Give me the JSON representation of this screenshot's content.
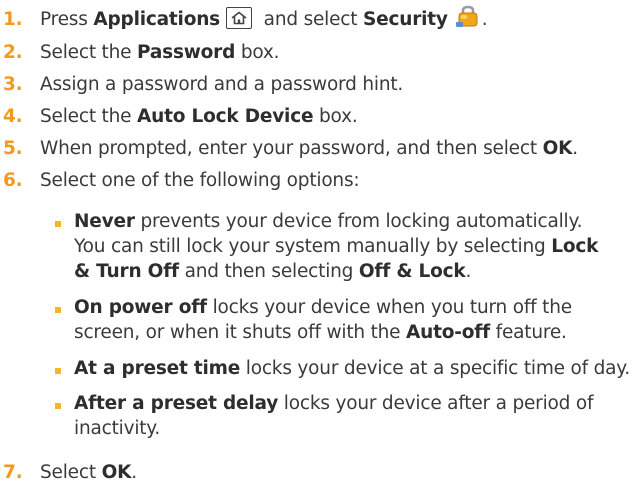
{
  "steps": [
    {
      "num": "1.",
      "parts": [
        "Press ",
        "Applications",
        " and select ",
        "Security",
        "."
      ],
      "icons": [
        "home-key-icon",
        "security-lock-icon"
      ]
    },
    {
      "num": "2.",
      "parts": [
        "Select the ",
        "Password",
        " box."
      ]
    },
    {
      "num": "3.",
      "text": "Assign a password and a password hint."
    },
    {
      "num": "4.",
      "parts": [
        "Select the ",
        "Auto Lock Device",
        " box."
      ]
    },
    {
      "num": "5.",
      "parts": [
        "When prompted, enter your password, and then select ",
        "OK",
        "."
      ]
    },
    {
      "num": "6.",
      "text": "Select one of the following options:"
    },
    {
      "num": "7.",
      "parts": [
        "Select ",
        "OK",
        "."
      ]
    }
  ],
  "options": [
    {
      "line1": [
        "Never",
        " prevents your device from locking automatically."
      ],
      "line2": [
        "You can still lock your system manually by selecting ",
        "Lock"
      ],
      "line3": [
        "& Turn Off",
        " and then selecting ",
        "Off & Lock",
        "."
      ]
    },
    {
      "line1": [
        "On power off",
        " locks your device when you turn off the"
      ],
      "line2": [
        "screen, or when it shuts off with the ",
        "Auto-off",
        " feature."
      ]
    },
    {
      "line1": [
        "At a preset time",
        " locks your device at a specific time of day."
      ]
    },
    {
      "line1": [
        "After a preset delay",
        " locks your device after a period of"
      ],
      "line2": [
        "inactivity."
      ]
    }
  ],
  "colors": {
    "number": "#f39a1e",
    "bullet": "#f5b825",
    "text": "#3a3a3a"
  }
}
